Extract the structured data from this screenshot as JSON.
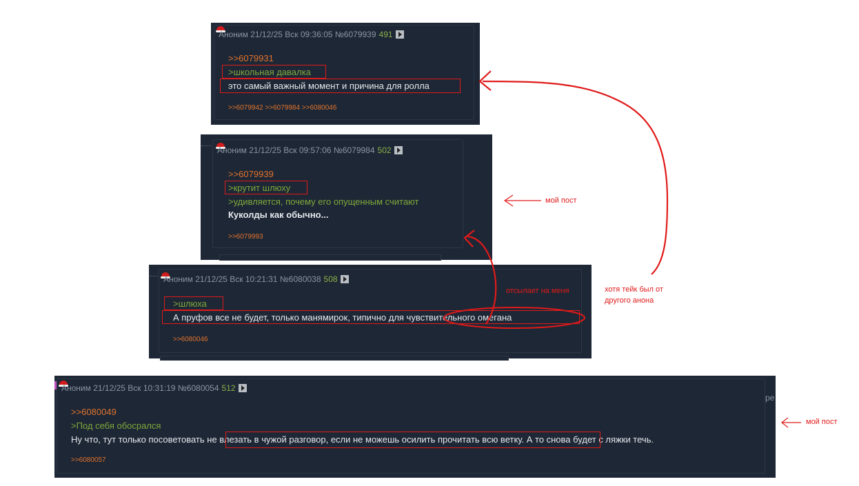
{
  "posts": [
    {
      "author": "Аноним",
      "datetime": "21/12/25 Вск 09:36:05",
      "post_id": "№6079939",
      "post_number": "491",
      "reply_link": ">>6079931",
      "quote_lines": [
        ">школьная давалка"
      ],
      "text": "это самый важный момент и причина для ролла",
      "replies": ">>6079942 >>6079984 >>6080046"
    },
    {
      "author": "Аноним",
      "datetime": "21/12/25 Вск 09:57:06",
      "post_id": "№6079984",
      "post_number": "502",
      "reply_link": ">>6079939",
      "quote_lines": [
        ">крутит шлюху",
        ">удивляется, почему его опущенным считают"
      ],
      "text": "Куколды как обычно...",
      "replies": ">>6079993"
    },
    {
      "author": "Аноним",
      "datetime": "21/12/25 Вск 10:21:31",
      "post_id": "№6080038",
      "post_number": "508",
      "reply_link": "",
      "quote_lines": [
        ">шлюха"
      ],
      "text": "А пруфов все не будет, только манямирок, типично для чувствительного омегана",
      "replies": ">>6080046"
    },
    {
      "author": "Аноним",
      "datetime": "21/12/25 Вск 10:31:19",
      "post_id": "№6080054",
      "post_number": "512",
      "reply_link": ">>6080049",
      "quote_lines": [
        ">Под себя обосрался"
      ],
      "text": "Ну что, тут только посоветовать не влезать в чужой разговор, если не можешь осилить прочитать всю ветку. А то снова будет с ляжки течь.",
      "replies": ">>6080057"
    }
  ],
  "annotations": {
    "my_post_1": "мой пост",
    "refers_to_me": "отсылает на меня",
    "take_from_other": "хотя тейк был от",
    "take_from_other_2": "другого анона",
    "my_post_2": "мой пост"
  },
  "colors": {
    "background": "#1e2735",
    "reply_link": "#e0732e",
    "greentext": "#7faa3b",
    "text": "#e6e9ee",
    "annotation_red": "#e01a1a"
  }
}
